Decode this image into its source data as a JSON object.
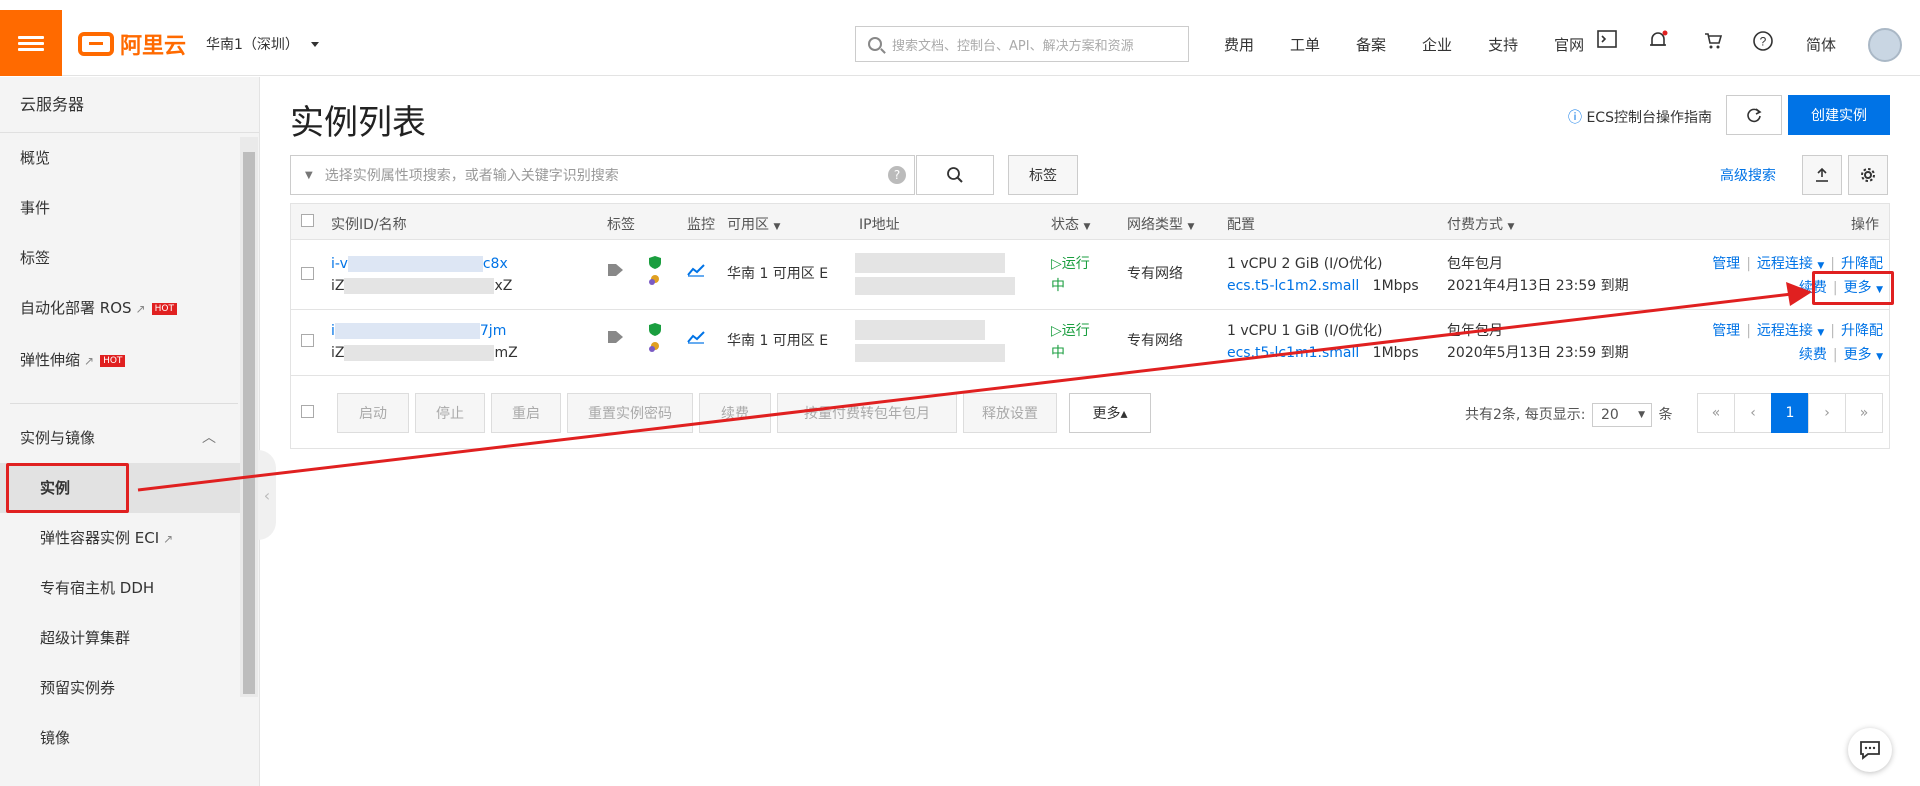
{
  "header": {
    "brand": "阿里云",
    "region": "华南1（深圳）",
    "search_placeholder": "搜索文档、控制台、API、解决方案和资源",
    "nav": [
      "费用",
      "工单",
      "备案",
      "企业",
      "支持",
      "官网"
    ],
    "lang": "简体",
    "icons": [
      "terminal-icon",
      "bell-icon",
      "cart-icon",
      "help-icon"
    ]
  },
  "sidebar": {
    "title": "云服务器",
    "items": [
      "概览",
      "事件",
      "标签",
      "自动化部署 ROS",
      "弹性伸缩"
    ],
    "hot": "HOT",
    "group": "实例与镜像",
    "sub_items": [
      "实例",
      "弹性容器实例 ECI",
      "专有宿主机 DDH",
      "超级计算集群",
      "预留实例券",
      "镜像"
    ],
    "selected": "实例"
  },
  "main": {
    "title": "实例列表",
    "guide": "ECS控制台操作指南",
    "create_label": "创建实例",
    "filter_placeholder": "选择实例属性项搜索，或者输入关键字识别搜索",
    "tag_button": "标签",
    "advanced_search": "高级搜索"
  },
  "table": {
    "headers": [
      "实例ID/名称",
      "标签",
      "监控",
      "可用区",
      "IP地址",
      "状态",
      "网络类型",
      "配置",
      "付费方式",
      "操作"
    ],
    "rows": [
      {
        "id_prefix": "i-v",
        "id_suffix": "c8x",
        "name_prefix": "iZ",
        "name_suffix": "xZ",
        "zone": "华南 1 可用区 E",
        "status_line1": "运行",
        "status_line2": "中",
        "network": "专有网络",
        "config_line1": "1 vCPU 2 GiB (I/O优化)",
        "config_type": "ecs.t5-lc1m2.small",
        "bandwidth": "1Mbps",
        "billing_line1": "包年包月",
        "billing_line2": "2021年4月13日 23:59 到期",
        "ops_manage": "管理",
        "ops_remote": "远程连接",
        "ops_upgrade": "升降配",
        "ops_renew": "续费",
        "ops_more": "更多"
      },
      {
        "id_prefix": "i",
        "id_suffix": "7jm",
        "name_prefix": "iZ",
        "name_suffix": "mZ",
        "zone": "华南 1 可用区 E",
        "status_line1": "运行",
        "status_line2": "中",
        "network": "专有网络",
        "config_line1": "1 vCPU 1 GiB (I/O优化)",
        "config_type": "ecs.t5-lc1m1.small",
        "bandwidth": "1Mbps",
        "billing_line1": "包年包月",
        "billing_line2": "2020年5月13日 23:59 到期",
        "ops_manage": "管理",
        "ops_remote": "远程连接",
        "ops_upgrade": "升降配",
        "ops_renew": "续费",
        "ops_more": "更多"
      }
    ],
    "batch_buttons": [
      "启动",
      "停止",
      "重启",
      "重置实例密码",
      "续费",
      "按量付费转包年包月",
      "释放设置",
      "更多▴"
    ],
    "pagination": {
      "total_label": "共有2条, 每页显示:",
      "page_size": "20",
      "unit": "条",
      "pages": [
        "«",
        "‹",
        "1",
        "›",
        "»"
      ],
      "current": "1"
    }
  },
  "annotations": {
    "color": "#e02020",
    "note_targets": [
      "实例",
      "更多"
    ]
  }
}
